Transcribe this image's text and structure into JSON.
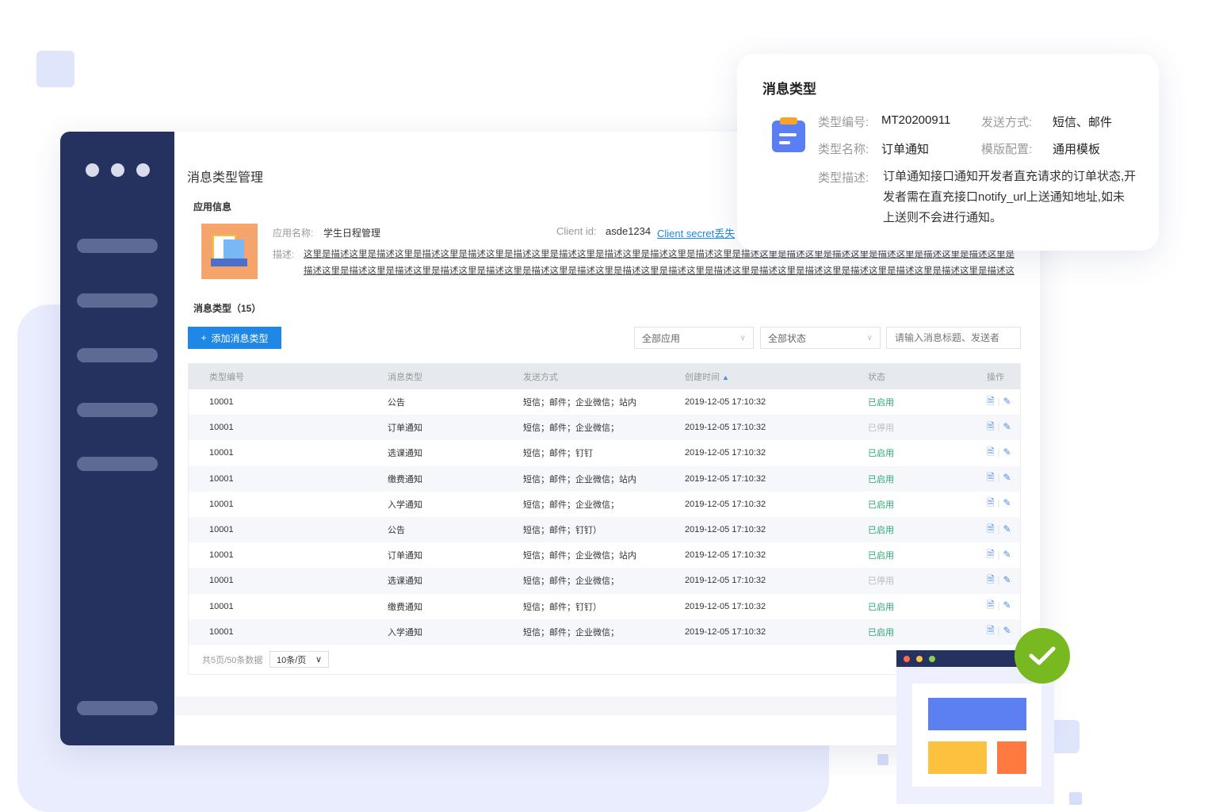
{
  "page": {
    "title": "消息类型管理"
  },
  "app_info": {
    "section_title": "应用信息",
    "name_label": "应用名称:",
    "name_value": "学生日程管理",
    "client_id_label": "Client id:",
    "client_id_value": "asde1234",
    "client_secret_link": "Client secret丢失",
    "desc_label": "描述:",
    "desc_value": "这里是描述这里是描述这里是描述这里是描述这里是描述这里是描述这里是描述这里是描述这里是描述这里是描述这里是描述这里是描述这里是描述这里是描述这里是描述这里是描述这里是描述这里是描述这里是描述这里是描述这里是描述这里是描述这里是描述这里是描述这里是描述这里是描述这里是描述这里是描述这里是描述这里是描述这里是描述这里是描述"
  },
  "types_section": {
    "title": "消息类型（15）",
    "add_button": "添加消息类型",
    "filter_app": "全部应用",
    "filter_status": "全部状态",
    "search_placeholder": "请输入消息标题、发送者"
  },
  "table": {
    "headers": [
      "类型编号",
      "消息类型",
      "发送方式",
      "创建时间",
      "状态",
      "操作"
    ],
    "rows": [
      {
        "id": "10001",
        "type": "公告",
        "method": "短信；邮件；企业微信；站内",
        "time": "2019-12-05  17:10:32",
        "status": "已启用",
        "enabled": true
      },
      {
        "id": "10001",
        "type": "订单通知",
        "method": "短信；邮件；企业微信；",
        "time": "2019-12-05  17:10:32",
        "status": "已停用",
        "enabled": false
      },
      {
        "id": "10001",
        "type": "选课通知",
        "method": "短信；邮件；钉钉",
        "time": "2019-12-05  17:10:32",
        "status": "已启用",
        "enabled": true
      },
      {
        "id": "10001",
        "type": "缴费通知",
        "method": "短信；邮件；企业微信；站内",
        "time": "2019-12-05  17:10:32",
        "status": "已启用",
        "enabled": true
      },
      {
        "id": "10001",
        "type": "入学通知",
        "method": "短信；邮件；企业微信；",
        "time": "2019-12-05  17:10:32",
        "status": "已启用",
        "enabled": true
      },
      {
        "id": "10001",
        "type": "公告",
        "method": "短信；邮件；钉钉）",
        "time": "2019-12-05  17:10:32",
        "status": "已启用",
        "enabled": true
      },
      {
        "id": "10001",
        "type": "订单通知",
        "method": "短信；邮件；企业微信；站内",
        "time": "2019-12-05  17:10:32",
        "status": "已启用",
        "enabled": true
      },
      {
        "id": "10001",
        "type": "选课通知",
        "method": "短信；邮件；企业微信；",
        "time": "2019-12-05  17:10:32",
        "status": "已停用",
        "enabled": false
      },
      {
        "id": "10001",
        "type": "缴费通知",
        "method": "短信；邮件；钉钉）",
        "time": "2019-12-05  17:10:32",
        "status": "已启用",
        "enabled": true
      },
      {
        "id": "10001",
        "type": "入学通知",
        "method": "短信；邮件；企业微信；",
        "time": "2019-12-05  17:10:32",
        "status": "已启用",
        "enabled": true
      }
    ]
  },
  "pager": {
    "summary": "共5页/50条数据",
    "page_size": "10条/页"
  },
  "detail_card": {
    "title": "消息类型",
    "code_label": "类型编号:",
    "code_value": "MT20200911",
    "send_label": "发送方式:",
    "send_value": "短信、邮件",
    "name_label": "类型名称:",
    "name_value": "订单通知",
    "template_label": "模版配置:",
    "template_value": "通用模板",
    "desc_label": "类型描述:",
    "desc_value": "订单通知接口通知开发者直充请求的订单状态,开发者需在直充接口notify_url上送通知地址,如未上送则不会进行通知。"
  },
  "colors": {
    "sidebar": "#25325f",
    "primary": "#1f87e5",
    "enabled": "#2aa876",
    "disabled": "#bbbbbb",
    "success_badge": "#78b922"
  },
  "icons": [
    "plus-icon",
    "chevron-down-icon",
    "sort-icon",
    "doc-icon",
    "edit-icon",
    "clipboard-icon",
    "check-icon"
  ]
}
